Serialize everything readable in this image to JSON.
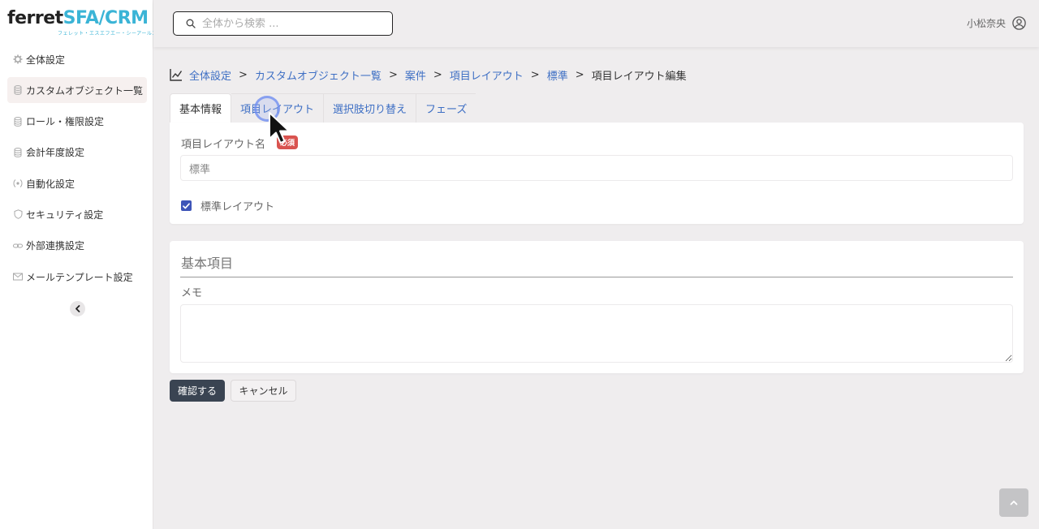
{
  "logo": {
    "text_a": "ferret",
    "text_b": "SFA/CRM",
    "sub": "フェレット・エスエフエー・シーアールエム"
  },
  "sidebar": {
    "items": [
      {
        "label": "全体設定",
        "icon": "gear-icon"
      },
      {
        "label": "カスタムオブジェクト一覧",
        "icon": "database-icon"
      },
      {
        "label": "ロール・権限設定",
        "icon": "database-icon"
      },
      {
        "label": "会計年度設定",
        "icon": "database-icon"
      },
      {
        "label": "自動化設定",
        "icon": "automation-icon"
      },
      {
        "label": "セキュリティ設定",
        "icon": "shield-icon"
      },
      {
        "label": "外部連携設定",
        "icon": "link-icon"
      },
      {
        "label": "メールテンプレート設定",
        "icon": "mail-icon"
      }
    ],
    "active_index": 1
  },
  "header": {
    "search_placeholder": "全体から検索 ...",
    "user_name": "小松奈央"
  },
  "breadcrumb": {
    "items": [
      "全体設定",
      "カスタムオブジェクト一覧",
      "案件",
      "項目レイアウト",
      "標準"
    ],
    "current": "項目レイアウト編集",
    "separator": ">"
  },
  "tabs": [
    {
      "label": "基本情報",
      "active": true
    },
    {
      "label": "項目レイアウト",
      "active": false
    },
    {
      "label": "選択肢切り替え",
      "active": false
    },
    {
      "label": "フェーズ",
      "active": false
    }
  ],
  "form": {
    "layout_name_label": "項目レイアウト名",
    "required_badge": "必須",
    "layout_name_value": "標準",
    "standard_layout_label": "標準レイアウト",
    "standard_layout_checked": true
  },
  "basic_section": {
    "title": "基本項目",
    "memo_label": "メモ"
  },
  "buttons": {
    "confirm": "確認する",
    "cancel": "キャンセル"
  },
  "colors": {
    "accent": "#3e6fc4",
    "primary_button": "#3a4452",
    "required": "#d9534f",
    "logo_blue": "#3bb4d6"
  }
}
